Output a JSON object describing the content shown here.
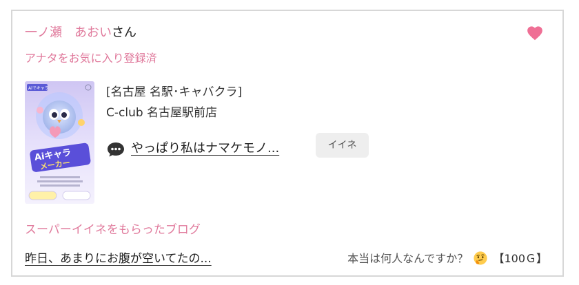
{
  "user": {
    "name_pink": "一ノ瀬　あおい",
    "name_suffix": "さん",
    "favorite_status": "アナタをお気に入り登録済"
  },
  "icons": {
    "favorite": "heart-icon",
    "comment": "speech-bubble-icon",
    "emoji": "thinking-face-emoji"
  },
  "colors": {
    "accent_pink": "#e07a9c",
    "heart": "#ef6f95",
    "button_bg": "#eeeeee"
  },
  "post": {
    "category": "[名古屋 名駅･キャバクラ]",
    "shop": "C-club 名古屋駅前店",
    "comment": "やっぱり私はナマケモノ...",
    "iine_label": "イイネ",
    "thumbnail_logo": "Aiでキャラ",
    "thumbnail_title_1": "Aiキャラ",
    "thumbnail_title_2": "メーカー"
  },
  "super_iine": {
    "heading": "スーパーイイネをもらったブログ",
    "blog_title": "昨日、あまりにお腹が空いてたの...",
    "comment": "本当は何人なんですか？",
    "points": "【100Ｇ】"
  }
}
